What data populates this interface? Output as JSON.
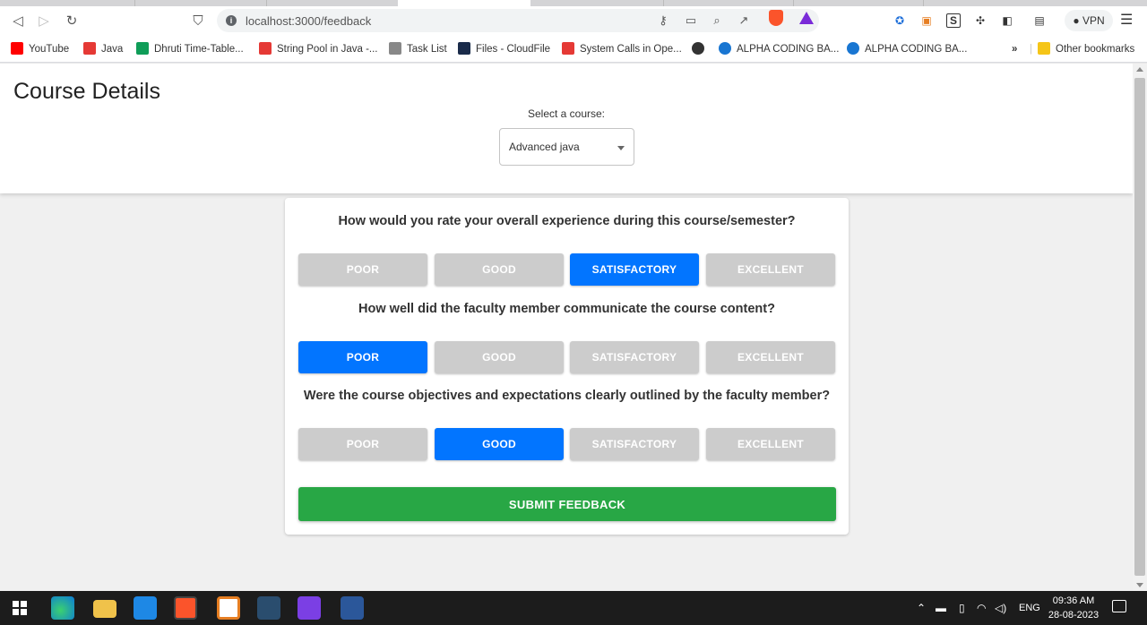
{
  "browser": {
    "url": "localhost:3000/feedback",
    "vpn_label": "VPN"
  },
  "bookmarks": [
    {
      "label": "YouTube",
      "icon": "youtube-icon",
      "color": "#ff0000"
    },
    {
      "label": "Java",
      "icon": "brave-v-icon",
      "color": "#e53935"
    },
    {
      "label": "Dhruti Time-Table...",
      "icon": "sheets-icon",
      "color": "#0f9d58"
    },
    {
      "label": "String Pool in Java -...",
      "icon": "brave-v-icon",
      "color": "#e53935"
    },
    {
      "label": "Task List",
      "icon": "scissors-icon",
      "color": "#888888"
    },
    {
      "label": "Files - CloudFile",
      "icon": "cloud-icon",
      "color": "#1a2b4a"
    },
    {
      "label": "System Calls in Ope...",
      "icon": "brave-v-icon",
      "color": "#e53935"
    },
    {
      "label": "",
      "icon": "globe-icon",
      "color": "#333333"
    },
    {
      "label": "ALPHA CODING BA...",
      "icon": "alpha-icon",
      "color": "#1976d2"
    },
    {
      "label": "ALPHA CODING BA...",
      "icon": "alpha-icon",
      "color": "#1976d2"
    }
  ],
  "bookmarks_overflow": "»",
  "other_bookmarks": "Other bookmarks",
  "page": {
    "title": "Course Details",
    "select_label": "Select a course:",
    "selected_course": "Advanced java"
  },
  "questions": [
    {
      "text": "How would you rate your overall experience during this course/semester?",
      "selected": 2
    },
    {
      "text": "How well did the faculty member communicate the course content?",
      "selected": 0
    },
    {
      "text": "Were the course objectives and expectations clearly outlined by the faculty member?",
      "selected": 1
    }
  ],
  "options": [
    "POOR",
    "GOOD",
    "SATISFACTORY",
    "EXCELLENT"
  ],
  "submit_label": "SUBMIT FEEDBACK",
  "colors": {
    "selected": "#0275ff",
    "unselected": "#cccccc",
    "submit": "#28a745"
  },
  "taskbar": {
    "time": "09:36 AM",
    "date": "28-08-2023",
    "language": "ENG"
  }
}
